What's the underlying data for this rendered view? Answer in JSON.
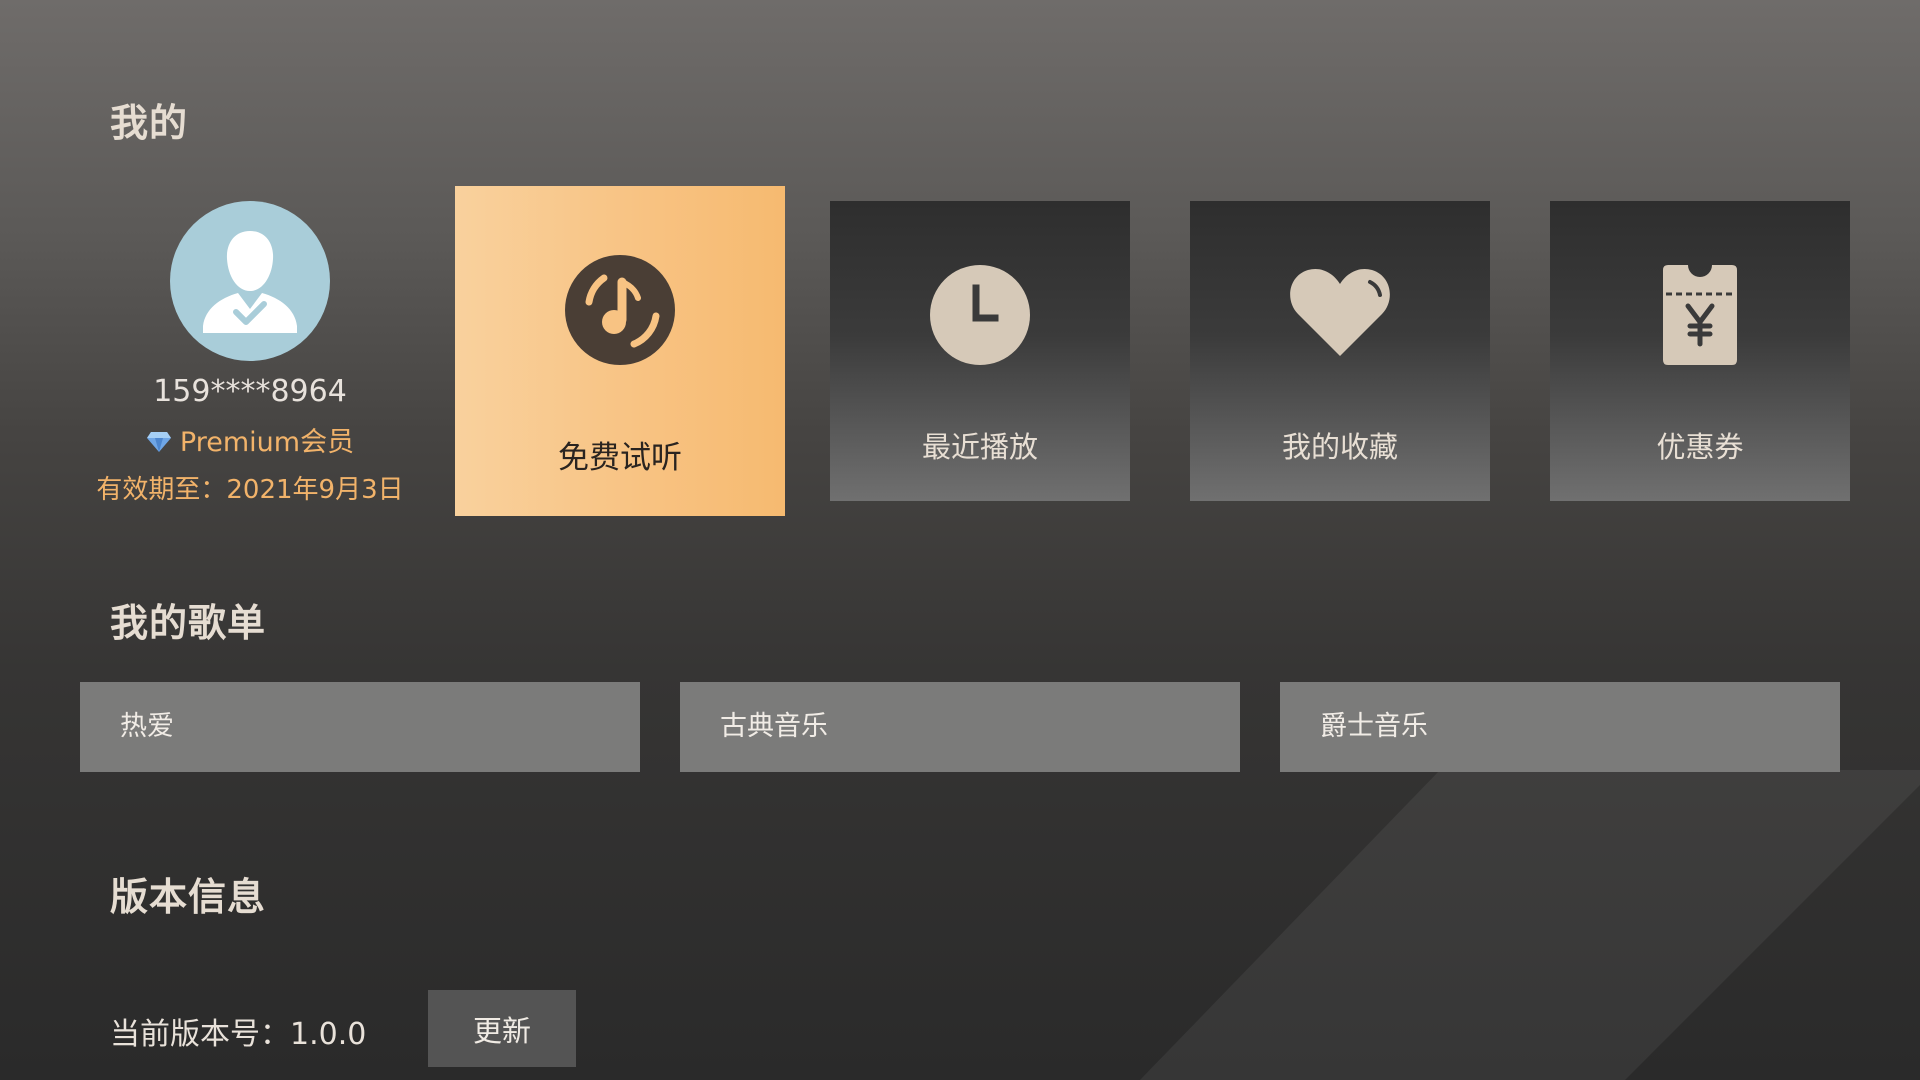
{
  "colors": {
    "accent_gold": "#f2b36a",
    "tile_highlight": "#f8c383",
    "tile_icon": "#d6c9b8",
    "avatar_bg": "#a9cdd9",
    "playlist_bg": "#7b7b7a"
  },
  "sections": {
    "mine": "我的",
    "playlists": "我的歌单",
    "version": "版本信息"
  },
  "profile": {
    "phone": "159****8964",
    "membership": "Premium会员",
    "expiry": "有效期至：2021年9月3日",
    "avatar_icon": "user-verified-icon",
    "membership_icon": "diamond-icon"
  },
  "tiles": [
    {
      "label": "免费试听",
      "icon": "music-disc-icon"
    },
    {
      "label": "最近播放",
      "icon": "clock-icon"
    },
    {
      "label": "我的收藏",
      "icon": "heart-icon"
    },
    {
      "label": "优惠券",
      "icon": "coupon-icon"
    }
  ],
  "playlists": [
    {
      "name": "热爱"
    },
    {
      "name": "古典音乐"
    },
    {
      "name": "爵士音乐"
    }
  ],
  "version": {
    "label": "当前版本号：1.0.0",
    "update_button": "更新"
  }
}
